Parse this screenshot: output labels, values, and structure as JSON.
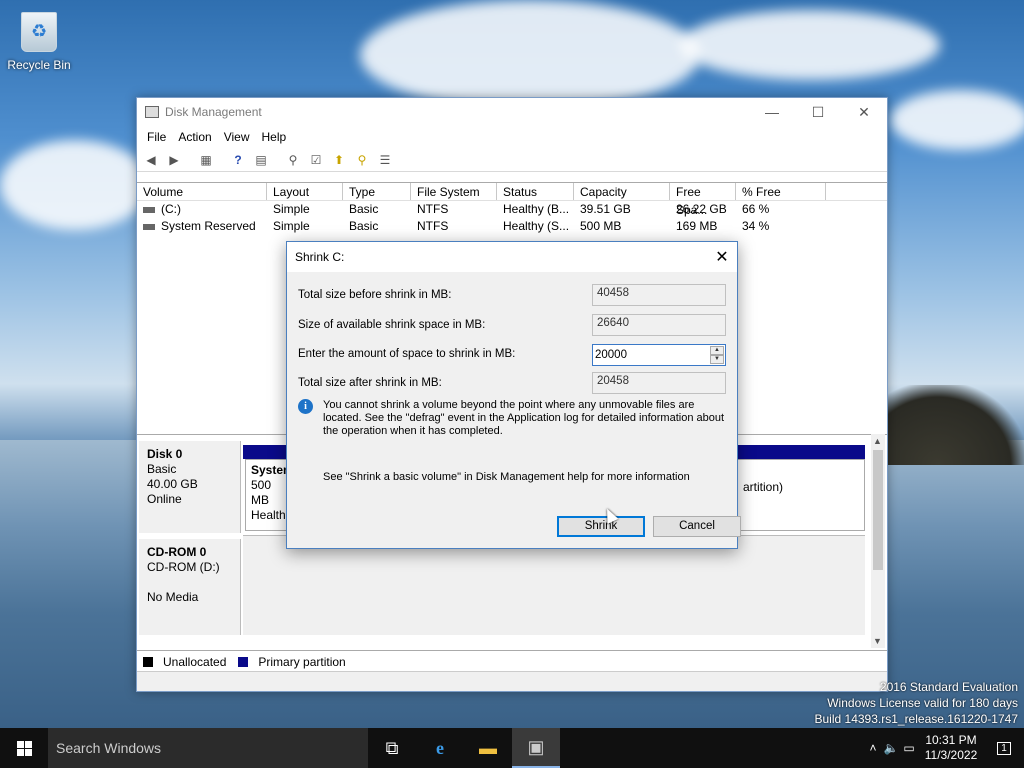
{
  "desktop": {
    "recycle_bin_label": "Recycle Bin",
    "watermark": [
      "2016 Standard Evaluation",
      "Windows License valid for 180 days",
      "Build 14393.rs1_release.161220-1747"
    ]
  },
  "window": {
    "title": "Disk Management",
    "menu": [
      "File",
      "Action",
      "View",
      "Help"
    ],
    "columns": [
      "Volume",
      "Layout",
      "Type",
      "File System",
      "Status",
      "Capacity",
      "Free Spa...",
      "% Free"
    ],
    "volumes": [
      {
        "volume": "(C:)",
        "layout": "Simple",
        "type": "Basic",
        "fs": "NTFS",
        "status": "Healthy (B...",
        "capacity": "39.51 GB",
        "free": "26.22 GB",
        "pct": "66 %"
      },
      {
        "volume": "System Reserved",
        "layout": "Simple",
        "type": "Basic",
        "fs": "NTFS",
        "status": "Healthy (S...",
        "capacity": "500 MB",
        "free": "169 MB",
        "pct": "34 %"
      }
    ],
    "disk0": {
      "name": "Disk 0",
      "type": "Basic",
      "size": "40.00 GB",
      "state": "Online"
    },
    "partition_system": {
      "name": "System",
      "size": "500 MB",
      "status": "Health"
    },
    "partition_c_tail": "artition)",
    "cdrom": {
      "name": "CD-ROM 0",
      "drive": "CD-ROM (D:)",
      "media": "No Media"
    },
    "legend": {
      "unallocated": "Unallocated",
      "primary": "Primary partition",
      "unallocated_color": "#000000",
      "primary_color": "#0a0a8a"
    }
  },
  "dialog": {
    "title": "Shrink C:",
    "label_total_before": "Total size before shrink in MB:",
    "value_total_before": "40458",
    "label_available": "Size of available shrink space in MB:",
    "value_available": "26640",
    "label_enter": "Enter the amount of space to shrink in MB:",
    "value_enter": "20000",
    "label_total_after": "Total size after shrink in MB:",
    "value_total_after": "20458",
    "info_text": "You cannot shrink a volume beyond the point where any unmovable files are located. See the \"defrag\" event in the Application log for detailed information about the operation when it has completed.",
    "help_text": "See \"Shrink a basic volume\" in Disk Management help for more information",
    "shrink_button": "Shrink",
    "cancel_button": "Cancel"
  },
  "taskbar": {
    "search_placeholder": "Search Windows",
    "time": "10:31 PM",
    "date": "11/3/2022",
    "notification_count": "1"
  }
}
